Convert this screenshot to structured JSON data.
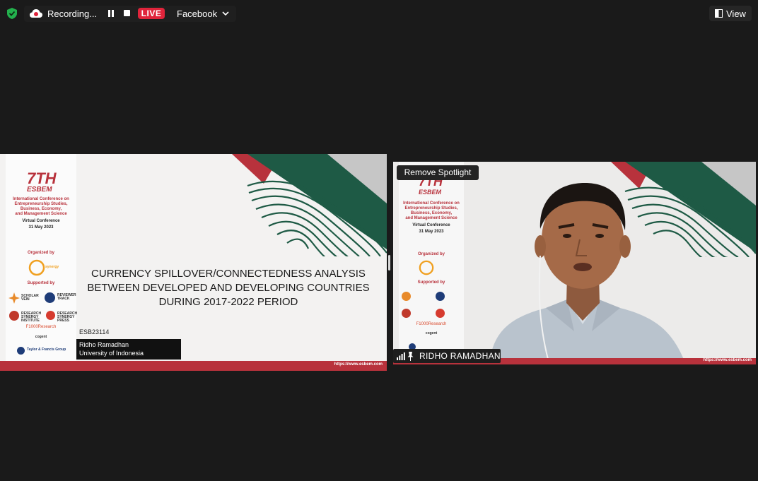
{
  "topbar": {
    "recording_label": "Recording...",
    "live_label": "LIVE",
    "platform_label": "Facebook",
    "view_label": "View"
  },
  "slide": {
    "conference": {
      "number": "7TH",
      "name": "ESBEM",
      "lines": [
        "International Conference on",
        "Entrepreneurship Studies,",
        "Business, Economy,",
        "and Management Science"
      ],
      "mode": "Virtual Conference",
      "date": "31 May 2023"
    },
    "organized_by_label": "Organized by",
    "supported_by_label": "Supported by",
    "sponsors": {
      "scholar_vein": "SCHOLAR VEIN",
      "reviewer_track": "REVIEWER TRACK",
      "research_synergy_institute": "RESEARCH SYNERGY INSTITUTE",
      "research_synergy_press": "RESEARCH SYNERGY PRESS",
      "f1000": "F1000Research",
      "cogent": "cogent",
      "taylor_francis": "Taylor & Francis Group"
    },
    "title_lines": [
      "CURRENCY SPILLOVER/CONNECTEDNESS ANALYSIS",
      "BETWEEN DEVELOPED AND DEVELOPING COUNTRIES",
      "DURING 2017-2022 PERIOD"
    ],
    "paper_code": "ESB23114",
    "author": "Ridho Ramadhan",
    "institution": "University of Indonesia",
    "url": "https://www.esbem.com"
  },
  "video": {
    "remove_spotlight_label": "Remove Spotlight",
    "participant_name": "RIDHO RAMADHAN"
  },
  "colors": {
    "live_red": "#e0243b",
    "esbem_red": "#b8323c",
    "esbem_green": "#1e5a45"
  }
}
